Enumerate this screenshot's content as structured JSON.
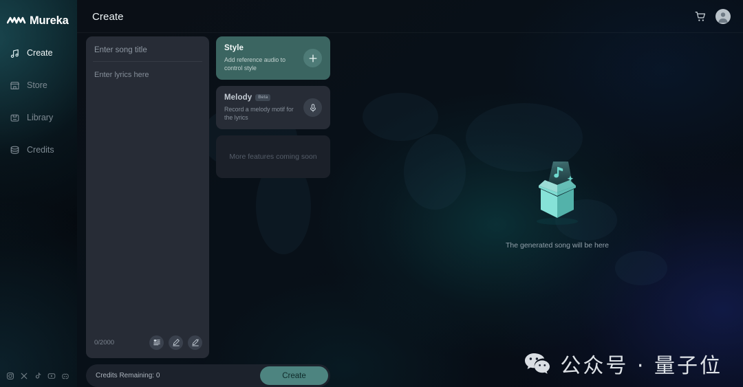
{
  "brand": {
    "name": "Mureka",
    "logo_icon": "waveform-logo-icon"
  },
  "sidebar": {
    "items": [
      {
        "label": "Create",
        "icon": "music-note-icon",
        "active": true
      },
      {
        "label": "Store",
        "icon": "store-icon",
        "active": false
      },
      {
        "label": "Library",
        "icon": "library-box-icon",
        "active": false
      },
      {
        "label": "Credits",
        "icon": "credits-stack-icon",
        "active": false
      }
    ],
    "socials": [
      {
        "name": "instagram-icon"
      },
      {
        "name": "x-twitter-icon"
      },
      {
        "name": "tiktok-icon"
      },
      {
        "name": "youtube-icon"
      },
      {
        "name": "discord-icon"
      }
    ]
  },
  "header": {
    "title": "Create",
    "cart_icon": "shopping-cart-icon",
    "avatar_icon": "user-avatar-icon"
  },
  "composer": {
    "title_placeholder": "Enter song title",
    "title_value": "",
    "lyrics_placeholder": "Enter lyrics here",
    "lyrics_value": "",
    "char_count": "0/2000",
    "tools": [
      {
        "name": "lyrics-template-icon"
      },
      {
        "name": "write-pencil-icon"
      },
      {
        "name": "ai-write-icon"
      }
    ]
  },
  "features": [
    {
      "title": "Style",
      "badge": "",
      "description": "Add reference audio to control style",
      "action_icon": "plus-icon",
      "accent": "#3b6561"
    },
    {
      "title": "Melody",
      "badge": "Beta",
      "description": "Record a melody motif for the lyrics",
      "action_icon": "microphone-icon",
      "accent": "#272c36"
    }
  ],
  "coming_soon": "More features coming soon",
  "footer": {
    "credits_label": "Credits Remaining: 0",
    "create_label": "Create"
  },
  "empty_state": {
    "text": "The generated song will be here",
    "art_icon": "open-box-music-icon"
  },
  "watermark": {
    "icon": "wechat-icon",
    "text": "公众号 · 量子位"
  },
  "colors": {
    "accent_teal": "#4d8480",
    "style_card": "#3b6561",
    "panel": "#272c36",
    "sidebar_bg": "#07171d"
  }
}
